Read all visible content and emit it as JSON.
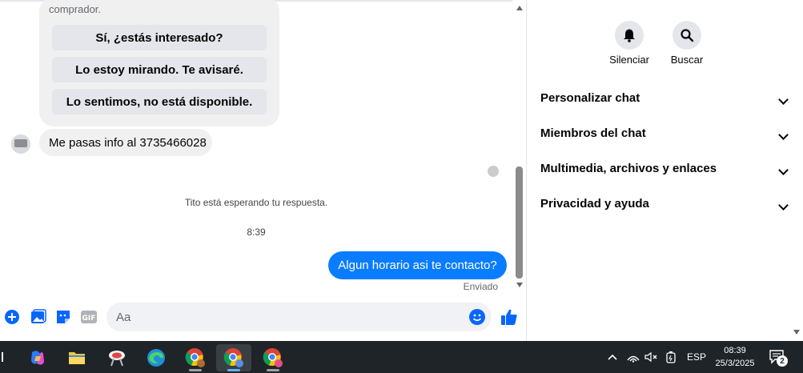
{
  "chat": {
    "card_text": "comprador.",
    "quick_replies": [
      "Sí, ¿estás interesado?",
      "Lo estoy mirando. Te avisaré.",
      "Lo sentimos, no está disponible."
    ],
    "incoming_message": "Me pasas info al 3735466028",
    "waiting_text": "Tito está esperando tu respuesta.",
    "time": "8:39",
    "outgoing_message": "Algun horario asi te contacto?",
    "sent_status": "Enviado"
  },
  "composer": {
    "placeholder": "Aa",
    "gif_label": "GIF",
    "icons": [
      "plus-icon",
      "image-icon",
      "sticker-icon",
      "gif-icon",
      "emoji-icon",
      "like-icon"
    ]
  },
  "sidebar": {
    "actions": [
      {
        "label": "Silenciar",
        "icon": "bell-icon"
      },
      {
        "label": "Buscar",
        "icon": "search-icon"
      }
    ],
    "sections": [
      "Personalizar chat",
      "Miembros del chat",
      "Multimedia, archivos y enlaces",
      "Privacidad y ayuda"
    ]
  },
  "taskbar": {
    "language": "ESP",
    "time": "08:39",
    "date": "25/3/2025",
    "notification_count": "2"
  },
  "colors": {
    "accent": "#0866ff",
    "outgoing_bubble": "#0a7cff",
    "incoming_bubble": "#f0f0f0",
    "taskbar": "#1f2428"
  }
}
